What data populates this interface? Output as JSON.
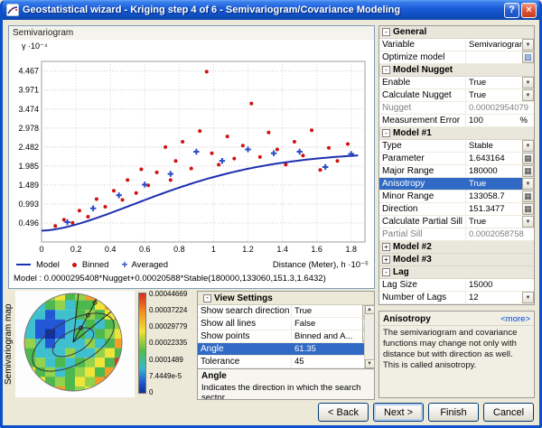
{
  "window": {
    "title": "Geostatistical wizard - Kriging step 4 of 6 - Semivariogram/Covariance Modeling"
  },
  "icons": {
    "help": "?",
    "close": "×",
    "dropdown": "▼",
    "calculator": "▦",
    "optimize": "▧",
    "collapse": "-",
    "expand": "+",
    "plus_marker": "+",
    "scroll_up": "▲",
    "scroll_down": "▼"
  },
  "chart_panel": {
    "title": "Semivariogram",
    "y_unit": "γ ·10⁻⁴",
    "x_axis_label": "Distance (Meter), h ·10⁻⁵",
    "legend": [
      "Model",
      "Binned",
      "Averaged"
    ],
    "model_text": "Model : 0.0000295408*Nugget+0.00020588*Stable(180000,133060,151.3,1.6432)"
  },
  "chart_data": {
    "type": "scatter",
    "title": "Semivariogram",
    "xlabel": "Distance (Meter), h (×10⁵)",
    "ylabel": "γ (×10⁻⁴)",
    "xlim": [
      0,
      1.88
    ],
    "ylim": [
      0,
      4.72
    ],
    "x_ticks": [
      "0",
      "0.2",
      "0.4",
      "0.6",
      "0.8",
      "1",
      "1.2",
      "1.4",
      "1.6",
      "1.8"
    ],
    "y_ticks": [
      "0.496",
      "0.993",
      "1.489",
      "1.985",
      "2.482",
      "2.978",
      "3.474",
      "3.971",
      "4.467"
    ],
    "grid": true,
    "colors": {
      "model": "#1c2fae",
      "binned": "#cf1110",
      "averaged": "#2b49c9"
    },
    "model": {
      "nugget": 2.954079e-05,
      "partial_sill": 0.0002058758,
      "major_range": 180000,
      "power": 1.6432
    },
    "binned": [
      [
        0.08,
        0.42
      ],
      [
        0.13,
        0.58
      ],
      [
        0.18,
        0.5
      ],
      [
        0.22,
        0.82
      ],
      [
        0.27,
        0.66
      ],
      [
        0.32,
        1.12
      ],
      [
        0.37,
        0.92
      ],
      [
        0.42,
        1.34
      ],
      [
        0.47,
        1.1
      ],
      [
        0.5,
        1.62
      ],
      [
        0.55,
        1.28
      ],
      [
        0.58,
        1.9
      ],
      [
        0.62,
        1.48
      ],
      [
        0.67,
        1.82
      ],
      [
        0.72,
        2.48
      ],
      [
        0.75,
        1.62
      ],
      [
        0.78,
        2.12
      ],
      [
        0.82,
        2.62
      ],
      [
        0.87,
        1.92
      ],
      [
        0.92,
        2.9
      ],
      [
        0.96,
        4.45
      ],
      [
        0.99,
        2.32
      ],
      [
        1.03,
        2.02
      ],
      [
        1.08,
        2.76
      ],
      [
        1.12,
        2.18
      ],
      [
        1.17,
        2.52
      ],
      [
        1.22,
        3.62
      ],
      [
        1.27,
        2.22
      ],
      [
        1.32,
        2.86
      ],
      [
        1.37,
        2.42
      ],
      [
        1.42,
        2.02
      ],
      [
        1.47,
        2.62
      ],
      [
        1.52,
        2.26
      ],
      [
        1.57,
        2.92
      ],
      [
        1.62,
        1.88
      ],
      [
        1.67,
        2.46
      ],
      [
        1.72,
        2.12
      ],
      [
        1.78,
        2.56
      ]
    ],
    "averaged": [
      [
        0.15,
        0.52
      ],
      [
        0.3,
        0.88
      ],
      [
        0.45,
        1.22
      ],
      [
        0.6,
        1.5
      ],
      [
        0.75,
        1.78
      ],
      [
        0.9,
        2.36
      ],
      [
        1.05,
        2.12
      ],
      [
        1.2,
        2.42
      ],
      [
        1.35,
        2.32
      ],
      [
        1.5,
        2.36
      ],
      [
        1.65,
        1.96
      ],
      [
        1.8,
        2.3
      ]
    ]
  },
  "map_panel": {
    "side_label": "Semivariogram map",
    "scale_labels": [
      "0.00044669",
      "0.00037224",
      "0.00029779",
      "0.00022335",
      "0.0001489",
      "7.4449e-5",
      "0"
    ],
    "palette": {
      "B": "#2257d6",
      "D": "#1130a0",
      "C": "#3fc0cf",
      "G": "#4db84d",
      "g": "#93d24b",
      "Y": "#efe53a",
      "O": "#f59d27",
      "R": "#e03c1f"
    },
    "grid": [
      "YOGgYGgORYGG",
      "OGCGgCGGYOGY",
      "GCCBCCGgGYRG",
      "YCBBBCCGCGgO",
      "GCBDBCGCGgYG",
      "OgCBCCCgCGOR",
      "GGCCCgCCgYGG",
      "YGgCGCGgYGRO",
      "GYGgCGgYGOYG",
      "OGYGgGYgORGY",
      "YOgYOGgYGGOG"
    ]
  },
  "view_settings": {
    "title": "View Settings",
    "rows": [
      {
        "label": "Show search direction",
        "value": "True",
        "control": "dropdown"
      },
      {
        "label": "Show all lines",
        "value": "False",
        "control": "dropdown"
      },
      {
        "label": "Show points",
        "value": "Binned and A...",
        "control": "dropdown"
      },
      {
        "label": "Angle",
        "value": "61.35",
        "selected": true
      },
      {
        "label": "Tolerance",
        "value": "45"
      }
    ],
    "description_title": "Angle",
    "description": "Indicates the direction in which the search sector"
  },
  "properties": {
    "rows": [
      {
        "kind": "group",
        "label": "General",
        "collapsed": false
      },
      {
        "kind": "prop",
        "label": "Variable",
        "value": "Semivariogram",
        "control": "dropdown"
      },
      {
        "kind": "prop",
        "label": "Optimize model",
        "value": "",
        "control": "optimize"
      },
      {
        "kind": "group",
        "label": "Model Nugget",
        "collapsed": false
      },
      {
        "kind": "prop",
        "label": "Enable",
        "value": "True",
        "control": "dropdown"
      },
      {
        "kind": "prop",
        "label": "Calculate Nugget",
        "value": "True",
        "control": "dropdown"
      },
      {
        "kind": "prop",
        "label": "Nugget",
        "value": "0.00002954079",
        "disabled": true
      },
      {
        "kind": "prop",
        "label": "Measurement Error",
        "value": "100",
        "suffix": "%"
      },
      {
        "kind": "group",
        "label": "Model #1",
        "collapsed": false
      },
      {
        "kind": "prop",
        "label": "Type",
        "value": "Stable",
        "control": "dropdown"
      },
      {
        "kind": "prop",
        "label": "Parameter",
        "value": "1.643164",
        "control": "calc"
      },
      {
        "kind": "prop",
        "label": "Major Range",
        "value": "180000",
        "control": "calc"
      },
      {
        "kind": "prop",
        "label": "Anisotropy",
        "value": "True",
        "control": "dropdown",
        "selected": true
      },
      {
        "kind": "prop",
        "label": "Minor Range",
        "value": "133058.7",
        "control": "calc"
      },
      {
        "kind": "prop",
        "label": "Direction",
        "value": "151.3477",
        "control": "calc"
      },
      {
        "kind": "prop",
        "label": "Calculate Partial Sill",
        "value": "True",
        "control": "dropdown"
      },
      {
        "kind": "prop",
        "label": "Partial Sill",
        "value": "0.0002058758",
        "disabled": true
      },
      {
        "kind": "group",
        "label": "Model #2",
        "collapsed": true
      },
      {
        "kind": "group",
        "label": "Model #3",
        "collapsed": true
      },
      {
        "kind": "group",
        "label": "Lag",
        "collapsed": false
      },
      {
        "kind": "prop",
        "label": "Lag Size",
        "value": "15000"
      },
      {
        "kind": "prop",
        "label": "Number of Lags",
        "value": "12",
        "control": "dropdown"
      }
    ]
  },
  "help_box": {
    "title": "Anisotropy",
    "more": "<more>",
    "text": "The semivariogram and covariance functions may change not only with distance but with direction as well. This is called anisotropy."
  },
  "buttons": {
    "back": "< Back",
    "next": "Next >",
    "finish": "Finish",
    "cancel": "Cancel"
  }
}
